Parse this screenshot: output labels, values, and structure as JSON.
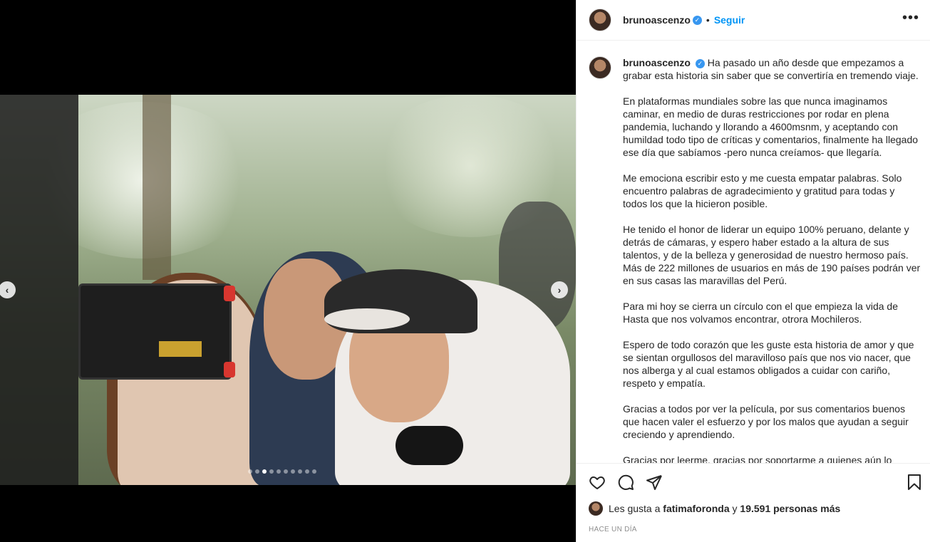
{
  "post": {
    "username": "brunoascenzo",
    "follow_label": "Seguir",
    "separator": "•",
    "more_label": "•••"
  },
  "carousel": {
    "slide_count": 10,
    "active_index": 2,
    "prev_label": "‹",
    "next_label": "›"
  },
  "caption": {
    "username": "brunoascenzo",
    "paragraphs": [
      "Ha pasado un año desde que empezamos a grabar esta historia sin saber que se convertiría en tremendo viaje.",
      "En plataformas mundiales sobre las que nunca imaginamos caminar, en medio de duras restricciones por rodar en plena pandemia, luchando y llorando a 4600msnm, y aceptando con humildad todo tipo de críticas y comentarios, finalmente ha llegado ese día que sabíamos -pero nunca creíamos- que llegaría.",
      "Me emociona escribir esto y me cuesta empatar palabras. Solo encuentro palabras de agradecimiento y gratitud para todas y todos los que la hicieron posible.",
      "He tenido el honor de liderar un equipo 100% peruano, delante y detrás de cámaras, y espero haber estado a la altura de sus talentos, y de la belleza y generosidad de nuestro hermoso país. Más de 222 millones de usuarios en más de 190 países podrán ver en sus casas las maravillas del Perú.",
      "Para mi hoy se cierra un círculo con el que empieza la vida de Hasta que nos volvamos encontrar, otrora Mochileros.",
      "Espero de todo corazón que les guste esta historia de amor y que se sientan orgullosos del maravilloso país que nos vio nacer, que nos alberga y al cual estamos obligados a cuidar con cariño, respeto y empatía.",
      "Gracias a todos por ver la película, por sus comentarios buenos que hacen valer el esfuerzo y por los malos que ayudan a seguir creciendo y aprendiendo.",
      "Gracias por leerme, gracias por soportarme a quienes aún lo hacen."
    ]
  },
  "likes": {
    "prefix": "Les gusta a",
    "user": "fatimaforonda",
    "conjunction": "y",
    "count_text": "19.591 personas más"
  },
  "timestamp": "HACE UN DÍA",
  "colors": {
    "accent": "#0095f6",
    "verified": "#3897f0",
    "muted": "#8e8e8e"
  },
  "icons": [
    "verified-badge-icon",
    "more-options-icon",
    "heart-icon",
    "comment-icon",
    "share-icon",
    "bookmark-icon",
    "chevron-left-icon",
    "chevron-right-icon"
  ]
}
